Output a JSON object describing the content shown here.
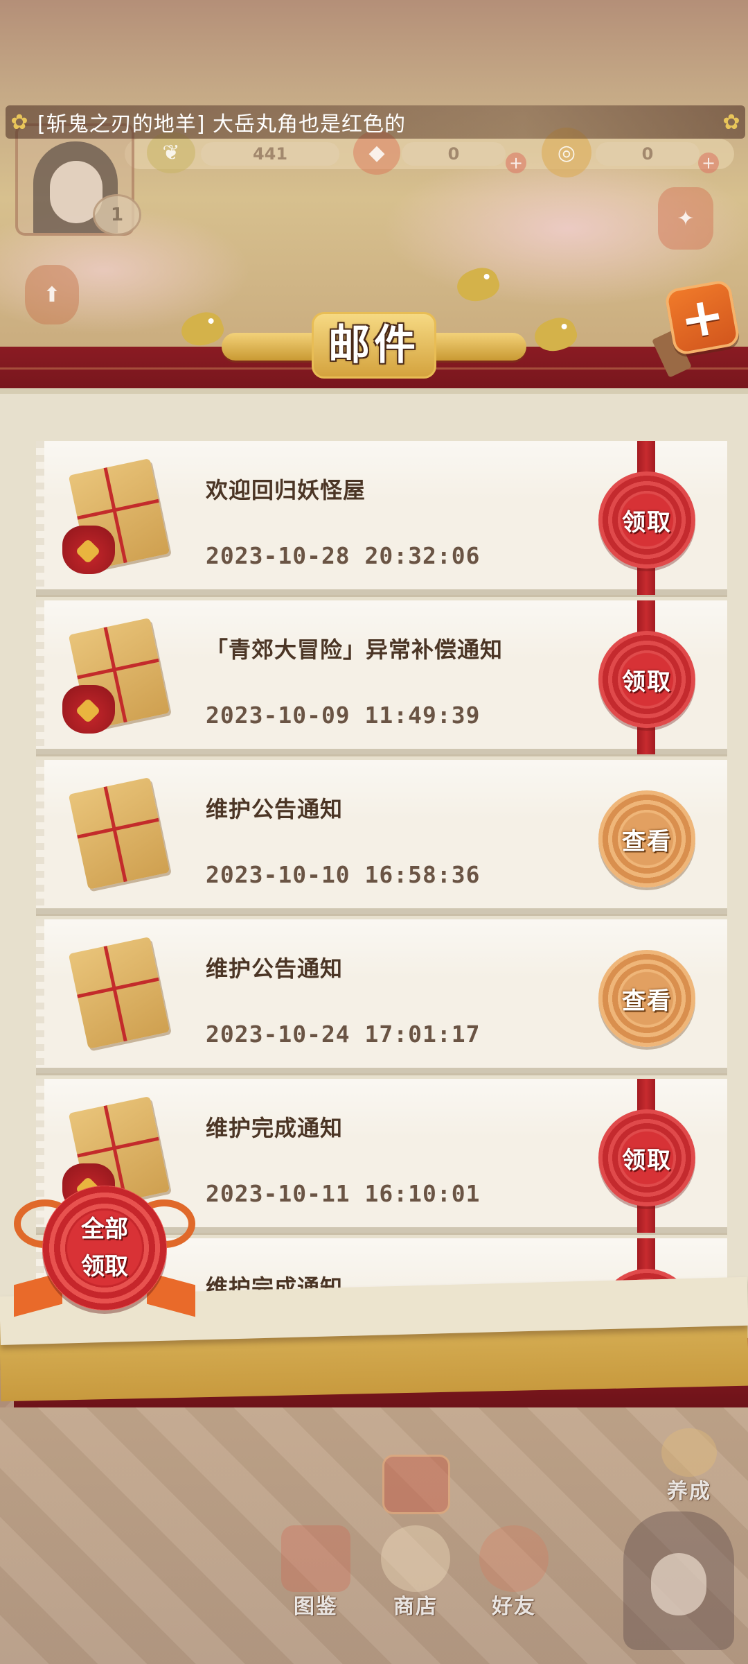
{
  "ticker": {
    "message": "[斩鬼之刃的地羊] 大岳丸角也是红色的"
  },
  "hud": {
    "level": "1",
    "counter_1": "441",
    "counter_2": "0",
    "counter_3": "0"
  },
  "header": {
    "title": "邮件",
    "add_label": "+"
  },
  "mails": [
    {
      "title": "欢迎回归妖怪屋",
      "time": "2023-10-28 20:32:06",
      "action": "领取",
      "style": "claim"
    },
    {
      "title": "「青郊大冒险」异常补偿通知",
      "time": "2023-10-09 11:49:39",
      "action": "领取",
      "style": "claim"
    },
    {
      "title": "维护公告通知",
      "time": "2023-10-10 16:58:36",
      "action": "查看",
      "style": "view"
    },
    {
      "title": "维护公告通知",
      "time": "2023-10-24 17:01:17",
      "action": "查看",
      "style": "view"
    },
    {
      "title": "维护完成通知",
      "time": "2023-10-11 16:10:01",
      "action": "领取",
      "style": "claim"
    },
    {
      "title": "维护完成通知",
      "time": "",
      "action": "",
      "style": "claim"
    }
  ],
  "claim_all": {
    "line1": "全部",
    "line2": "领取"
  },
  "dock": {
    "cultivate": "养成",
    "atlas": "图鉴",
    "shop": "商店",
    "friends": "好友"
  },
  "colors": {
    "claim_red": "#c6262b",
    "view_tan": "#d98f4e",
    "banner_red": "#8a1b23",
    "gold": "#d4a33e"
  }
}
